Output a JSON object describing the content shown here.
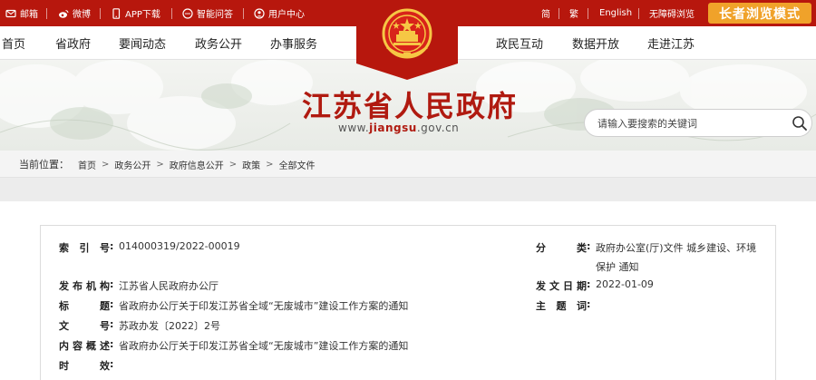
{
  "topbar": {
    "mail": "邮箱",
    "weibo": "微博",
    "app": "APP下载",
    "qa": "智能问答",
    "user": "用户中心",
    "simplified": "简",
    "traditional": "繁",
    "english": "English",
    "accessibility": "无障碍浏览",
    "elder_mode": "长者浏览模式"
  },
  "nav": {
    "left": [
      "首页",
      "省政府",
      "要闻动态",
      "政务公开",
      "办事服务"
    ],
    "right": [
      "政民互动",
      "数据开放",
      "走进江苏"
    ]
  },
  "banner": {
    "title": "江苏省人民政府",
    "url_prefix": "www.",
    "url_domain": "jiangsu",
    "url_suffix": ".gov.cn"
  },
  "search": {
    "placeholder": "请输入要搜索的关键词"
  },
  "breadcrumb": {
    "label": "当前位置：",
    "items": [
      "首页",
      "政务公开",
      "政府信息公开",
      "政策",
      "全部文件"
    ]
  },
  "info": {
    "index_label": "索 引 号",
    "index_value": "014000319/2022-00019",
    "category_label": "分 类",
    "category_value_line1": "政府办公室(厅)文件 城乡建设、环境",
    "category_value_line2": "保护 通知",
    "issuer_label": "发布机构",
    "issuer_value": "江苏省人民政府办公厅",
    "date_label": "发文日期",
    "date_value": "2022-01-09",
    "title_label": "标 题",
    "title_value": "省政府办公厅关于印发江苏省全域“无废城市”建设工作方案的通知",
    "subject_label": "主 题 词",
    "subject_value": "",
    "docno_label": "文 号",
    "docno_value": "苏政办发〔2022〕2号",
    "summary_label": "内容概述",
    "summary_value": "省政府办公厅关于印发江苏省全域“无废城市”建设工作方案的通知",
    "validity_label": "时 效",
    "validity_value": ""
  },
  "colors": {
    "brand_red": "#b7170d",
    "elder_orange": "#f0a22a",
    "title_red": "#b01a10",
    "gold": "#f6c744"
  }
}
